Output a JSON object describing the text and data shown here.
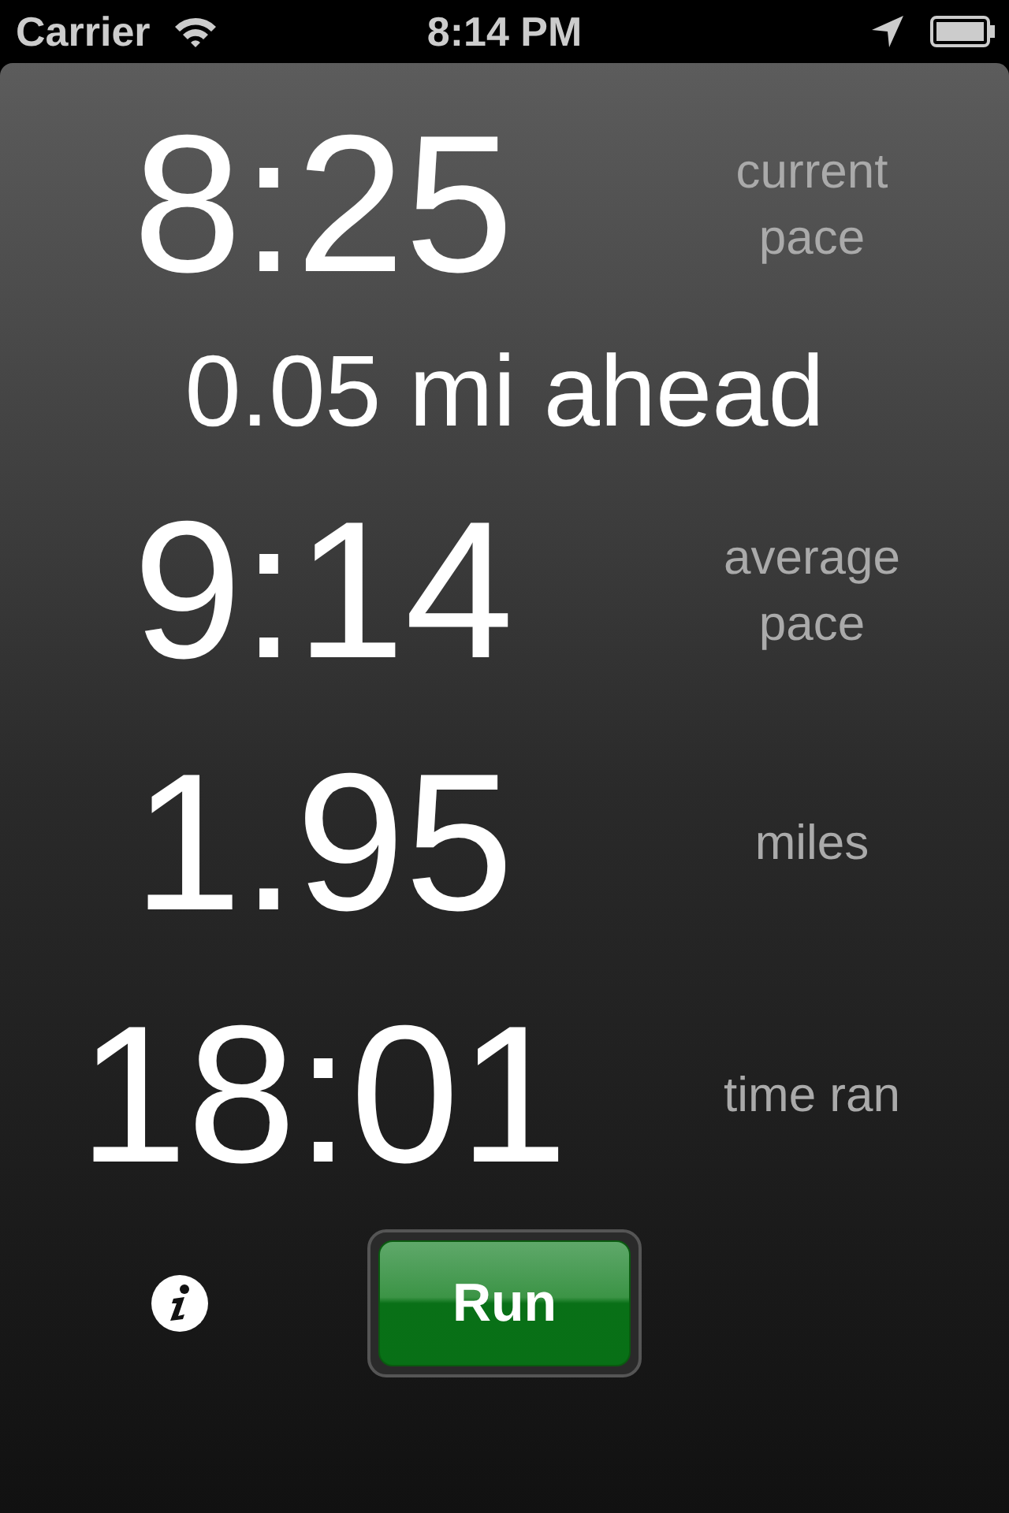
{
  "status_bar": {
    "carrier": "Carrier",
    "time": "8:14 PM"
  },
  "rows": [
    {
      "kind": "stat",
      "value": "8:25",
      "label": "current pace"
    },
    {
      "kind": "note",
      "value": "0.05 mi ahead"
    },
    {
      "kind": "stat",
      "value": "9:14",
      "label": "average pace"
    },
    {
      "kind": "stat",
      "value": "1.95",
      "label": "miles"
    },
    {
      "kind": "stat",
      "value": "18:01",
      "label": "time ran"
    }
  ],
  "run_button": {
    "label": "Run"
  }
}
